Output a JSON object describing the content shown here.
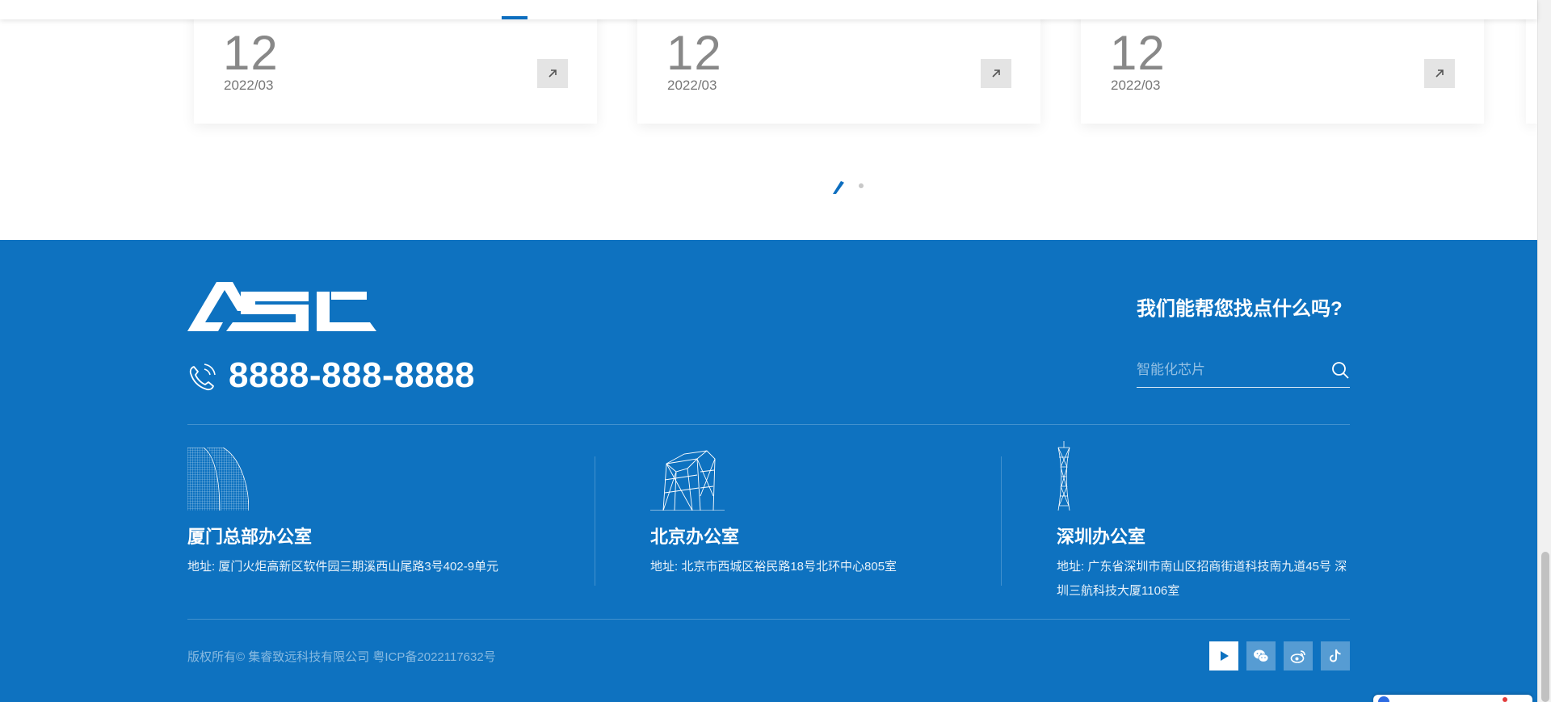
{
  "news_cards": [
    {
      "day": "12",
      "year_month": "2022/03",
      "arrow_icon": "arrow-up-right-icon"
    },
    {
      "day": "12",
      "year_month": "2022/03",
      "arrow_icon": "arrow-up-right-icon"
    },
    {
      "day": "12",
      "year_month": "2022/03",
      "arrow_icon": "arrow-up-right-icon"
    }
  ],
  "pager": {
    "total": 2,
    "active": 1
  },
  "footer": {
    "logo_text": "ASL",
    "phone": "8888-888-8888",
    "help_title": "我们能帮您找点什么吗?",
    "search": {
      "placeholder": "智能化芯片",
      "value": ""
    },
    "offices": [
      {
        "name": "厦门总部办公室",
        "address": "地址: 厦门火炬高新区软件园三期溪西山尾路3号402-9单元",
        "icon": "xiamen-building-icon"
      },
      {
        "name": "北京办公室",
        "address": "地址: 北京市西城区裕民路18号北环中心805室",
        "icon": "beijing-cctv-building-icon"
      },
      {
        "name": "深圳办公室",
        "address": "地址: 广东省深圳市南山区招商街道科技南九道45号 深圳三航科技大厦1106室",
        "icon": "shenzhen-tower-icon"
      }
    ],
    "copyright": "版权所有© 集睿致远科技有限公司 粤ICP备2022117632号",
    "social": [
      "video-play-icon",
      "wechat-icon",
      "weibo-icon",
      "douyin-icon"
    ]
  },
  "colors": {
    "brand_blue": "#0e72c0",
    "accent": "#0d6ebf"
  }
}
